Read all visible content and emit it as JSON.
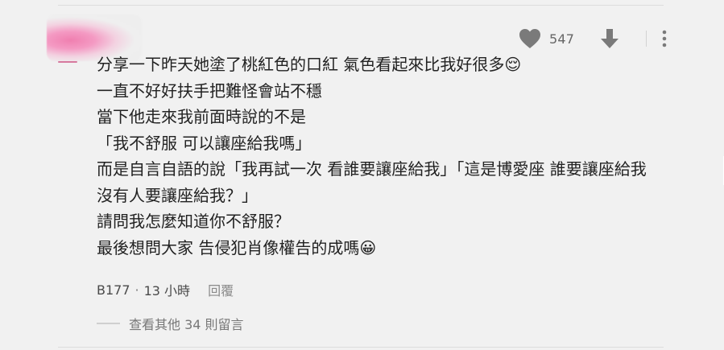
{
  "comment": {
    "actions": {
      "like_icon": "heart-icon",
      "like_count": "547",
      "dislike_icon": "arrow-down-icon",
      "more_icon": "vertical-dots-icon"
    },
    "lines": [
      "分享一下昨天她塗了桃紅色的口紅 氣色看起來比我好很多😌",
      "一直不好好扶手把難怪會站不穩",
      "當下他走來我前面時說的不是",
      "「我不舒服 可以讓座給我嗎」",
      "而是自言自語的說「我再試一次 看誰要讓座給我」「這是博愛座 誰要讓座給我",
      "沒有人要讓座給我？」",
      "請問我怎麼知道你不舒服？",
      "最後想問大家 告侵犯肖像權告的成嗎😀"
    ],
    "author": "B177",
    "separator": "·",
    "time": "13 小時",
    "reply_label": "回覆"
  },
  "replies": {
    "view_more_label": "查看其他 34 則留言"
  },
  "colors": {
    "background": "#f1f1f1",
    "text": "#222222",
    "icon": "#7a7a7a",
    "avatar_pink": "#f07fb0"
  }
}
